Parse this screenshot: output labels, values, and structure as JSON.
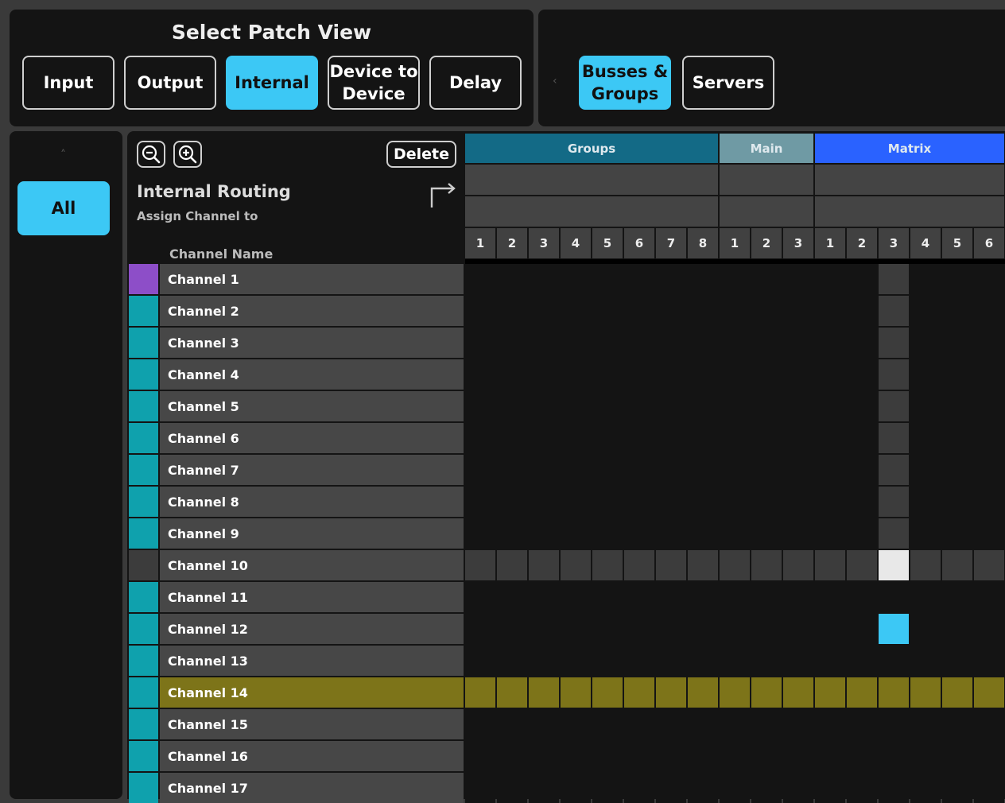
{
  "patch_view": {
    "title": "Select Patch View",
    "buttons": [
      {
        "label": "Input",
        "active": false
      },
      {
        "label": "Output",
        "active": false
      },
      {
        "label": "Internal",
        "active": true
      },
      {
        "label": "Device to Device",
        "active": false
      },
      {
        "label": "Delay",
        "active": false
      }
    ]
  },
  "category_tabs": {
    "prev_icon": "chevron-left-icon",
    "buttons": [
      {
        "label": "Busses & Groups",
        "active": true
      },
      {
        "label": "Servers",
        "active": false
      }
    ]
  },
  "filter": {
    "up_icon": "chevron-up-icon",
    "all_label": "All"
  },
  "routing": {
    "zoom_out_icon": "zoom-out-icon",
    "zoom_in_icon": "zoom-in-icon",
    "delete_label": "Delete",
    "title": "Internal Routing",
    "subtitle": "Assign Channel to",
    "swap_icon": "corner-up-right-icon",
    "channel_name_header": "Channel Name"
  },
  "groups": [
    {
      "name": "Groups",
      "color": "#136a86",
      "count": 8
    },
    {
      "name": "Main",
      "color": "#6f9aa4",
      "count": 3
    },
    {
      "name": "Matrix",
      "color": "#2a62ff",
      "count": 6
    }
  ],
  "column_numbers": [
    "1",
    "2",
    "3",
    "4",
    "5",
    "6",
    "7",
    "8",
    "1",
    "2",
    "3",
    "1",
    "2",
    "3",
    "4",
    "5",
    "6"
  ],
  "channels": [
    {
      "name": "Channel 1",
      "color": "#8d4ec8"
    },
    {
      "name": "Channel 2",
      "color": "#0fa1ad"
    },
    {
      "name": "Channel 3",
      "color": "#0fa1ad"
    },
    {
      "name": "Channel 4",
      "color": "#0fa1ad"
    },
    {
      "name": "Channel 5",
      "color": "#0fa1ad"
    },
    {
      "name": "Channel 6",
      "color": "#0fa1ad"
    },
    {
      "name": "Channel 7",
      "color": "#0fa1ad"
    },
    {
      "name": "Channel 8",
      "color": "#0fa1ad"
    },
    {
      "name": "Channel 9",
      "color": "#0fa1ad"
    },
    {
      "name": "Channel 10",
      "color": "#3c3c3c"
    },
    {
      "name": "Channel 11",
      "color": "#0fa1ad"
    },
    {
      "name": "Channel 12",
      "color": "#0fa1ad"
    },
    {
      "name": "Channel 13",
      "color": "#0fa1ad"
    },
    {
      "name": "Channel 14",
      "color": "#0fa1ad"
    },
    {
      "name": "Channel 15",
      "color": "#0fa1ad"
    },
    {
      "name": "Channel 16",
      "color": "#0fa1ad"
    },
    {
      "name": "Channel 17",
      "color": "#0fa1ad"
    }
  ],
  "grid_state": {
    "hover_row": 9,
    "hover_col": 13,
    "highlight_row": 13,
    "highlight_color": "#7d7419",
    "hover_cell_color": "#e8e8e8",
    "assigned": [
      {
        "row": 11,
        "col": 13,
        "color": "#3cc8f5"
      }
    ]
  }
}
